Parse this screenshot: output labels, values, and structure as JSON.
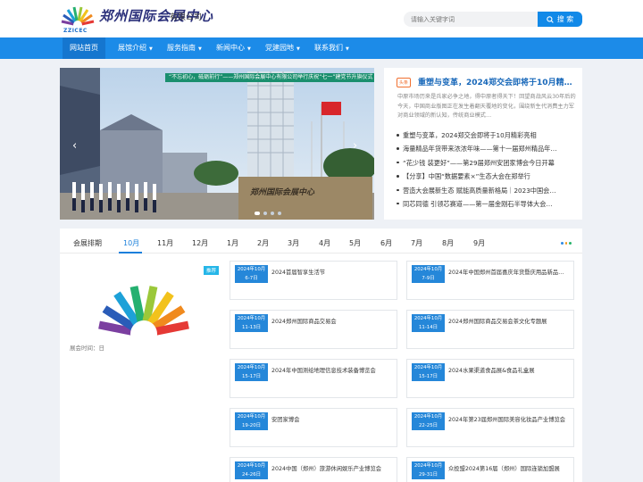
{
  "header": {
    "logo_text": "ZZICEC",
    "brand_name": "郑州国际会展中心",
    "brand_suffix": "有限公司",
    "search_placeholder": "请输入关键字词",
    "search_label": "搜 索"
  },
  "nav": {
    "items": [
      {
        "label": "网站首页",
        "active": true
      },
      {
        "label": "展馆介绍"
      },
      {
        "label": "服务指南"
      },
      {
        "label": "新闻中心"
      },
      {
        "label": "党建园地"
      },
      {
        "label": "联系我们"
      }
    ]
  },
  "banner": {
    "caption": "“不忘初心，砥砺前行”——郑州国际会展中心有限公司举行庆祝“七一”建党节升旗仪式",
    "sign_text": "郑州国际会展中心",
    "slides": 4,
    "active_slide": 0
  },
  "news": {
    "hot_badge": "头条",
    "headline": "重塑与变革，2024郑交会即将于10月精…",
    "summary": "中原市场历来是兵家必争之地，得中原者得天下！回望商战风云30年后的今天，中国商业版图正在发生着翻天覆地的变化，围绕新生代消费主力军对商业领域的新认知，传统商业模式…",
    "items": [
      "重塑与变革，2024郑交会即将于10月精彩亮相",
      "海量精品年货带来浓浓年味——第十一届郑州精品年…",
      "“花少钱 装更好”——第29届郑州安团家博会今日开幕",
      "【分享】中国“数据要素×”生态大会在郑举行",
      "营造大会展新生态 赋能高质量新格局｜2023中国会…",
      "同芯同德 引领芯赛道——第一届金刚石半导体大会…"
    ]
  },
  "schedule": {
    "label": "会展排期",
    "months": [
      "10月",
      "11月",
      "12月",
      "1月",
      "2月",
      "3月",
      "4月",
      "5月",
      "6月",
      "7月",
      "8月",
      "9月"
    ],
    "active_month": "10月",
    "featured": {
      "badge": "推荐",
      "time_label": "展会时间：日"
    },
    "cards": [
      {
        "date1": "2024年10月",
        "date2": "6-7日",
        "title": "2024首届智享生活节"
      },
      {
        "date1": "2024年10月",
        "date2": "7-9日",
        "title": "2024年中国郑州首届喜庆年货暨庆用品新品…"
      },
      {
        "date1": "2024年10月",
        "date2": "11-13日",
        "title": "2024郑州国际商品交易会"
      },
      {
        "date1": "2024年10月",
        "date2": "11-14日",
        "title": "2024郑州国际商品交易会茶文化专题展"
      },
      {
        "date1": "2024年10月",
        "date2": "15-17日",
        "title": "2024年中国测绘地理信息技术装备博览会"
      },
      {
        "date1": "2024年10月",
        "date2": "15-17日",
        "title": "2024水果渠道食品展&食品礼盒展"
      },
      {
        "date1": "2024年10月",
        "date2": "19-20日",
        "title": "安团家博会"
      },
      {
        "date1": "2024年10月",
        "date2": "22-25日",
        "title": "2024年第23届郑州国际美容化妆品产业博览会"
      },
      {
        "date1": "2024年10月",
        "date2": "24-26日",
        "title": "2024中国（郑州）旅游休闲娱乐产业博览会"
      },
      {
        "date1": "2024年10月",
        "date2": "29-31日",
        "title": "众投盟2024第16届（郑州）国际连锁加盟展"
      }
    ]
  },
  "colors": {
    "primary": "#1c8be8",
    "nav_active": "#1576cf",
    "headline": "#1767b9",
    "badge_blue": "#2587d9",
    "hot": "#f07030",
    "banner_caption": "#1a8f6e"
  }
}
